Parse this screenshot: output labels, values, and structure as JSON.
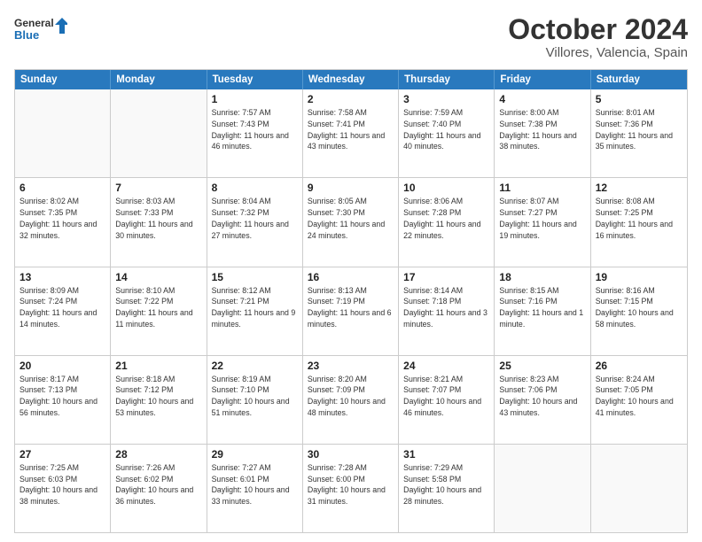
{
  "header": {
    "logo_line1": "General",
    "logo_line2": "Blue",
    "title": "October 2024",
    "subtitle": "Villores, Valencia, Spain"
  },
  "calendar": {
    "days_of_week": [
      "Sunday",
      "Monday",
      "Tuesday",
      "Wednesday",
      "Thursday",
      "Friday",
      "Saturday"
    ],
    "rows": [
      [
        {
          "day": "",
          "info": ""
        },
        {
          "day": "",
          "info": ""
        },
        {
          "day": "1",
          "info": "Sunrise: 7:57 AM\nSunset: 7:43 PM\nDaylight: 11 hours and 46 minutes."
        },
        {
          "day": "2",
          "info": "Sunrise: 7:58 AM\nSunset: 7:41 PM\nDaylight: 11 hours and 43 minutes."
        },
        {
          "day": "3",
          "info": "Sunrise: 7:59 AM\nSunset: 7:40 PM\nDaylight: 11 hours and 40 minutes."
        },
        {
          "day": "4",
          "info": "Sunrise: 8:00 AM\nSunset: 7:38 PM\nDaylight: 11 hours and 38 minutes."
        },
        {
          "day": "5",
          "info": "Sunrise: 8:01 AM\nSunset: 7:36 PM\nDaylight: 11 hours and 35 minutes."
        }
      ],
      [
        {
          "day": "6",
          "info": "Sunrise: 8:02 AM\nSunset: 7:35 PM\nDaylight: 11 hours and 32 minutes."
        },
        {
          "day": "7",
          "info": "Sunrise: 8:03 AM\nSunset: 7:33 PM\nDaylight: 11 hours and 30 minutes."
        },
        {
          "day": "8",
          "info": "Sunrise: 8:04 AM\nSunset: 7:32 PM\nDaylight: 11 hours and 27 minutes."
        },
        {
          "day": "9",
          "info": "Sunrise: 8:05 AM\nSunset: 7:30 PM\nDaylight: 11 hours and 24 minutes."
        },
        {
          "day": "10",
          "info": "Sunrise: 8:06 AM\nSunset: 7:28 PM\nDaylight: 11 hours and 22 minutes."
        },
        {
          "day": "11",
          "info": "Sunrise: 8:07 AM\nSunset: 7:27 PM\nDaylight: 11 hours and 19 minutes."
        },
        {
          "day": "12",
          "info": "Sunrise: 8:08 AM\nSunset: 7:25 PM\nDaylight: 11 hours and 16 minutes."
        }
      ],
      [
        {
          "day": "13",
          "info": "Sunrise: 8:09 AM\nSunset: 7:24 PM\nDaylight: 11 hours and 14 minutes."
        },
        {
          "day": "14",
          "info": "Sunrise: 8:10 AM\nSunset: 7:22 PM\nDaylight: 11 hours and 11 minutes."
        },
        {
          "day": "15",
          "info": "Sunrise: 8:12 AM\nSunset: 7:21 PM\nDaylight: 11 hours and 9 minutes."
        },
        {
          "day": "16",
          "info": "Sunrise: 8:13 AM\nSunset: 7:19 PM\nDaylight: 11 hours and 6 minutes."
        },
        {
          "day": "17",
          "info": "Sunrise: 8:14 AM\nSunset: 7:18 PM\nDaylight: 11 hours and 3 minutes."
        },
        {
          "day": "18",
          "info": "Sunrise: 8:15 AM\nSunset: 7:16 PM\nDaylight: 11 hours and 1 minute."
        },
        {
          "day": "19",
          "info": "Sunrise: 8:16 AM\nSunset: 7:15 PM\nDaylight: 10 hours and 58 minutes."
        }
      ],
      [
        {
          "day": "20",
          "info": "Sunrise: 8:17 AM\nSunset: 7:13 PM\nDaylight: 10 hours and 56 minutes."
        },
        {
          "day": "21",
          "info": "Sunrise: 8:18 AM\nSunset: 7:12 PM\nDaylight: 10 hours and 53 minutes."
        },
        {
          "day": "22",
          "info": "Sunrise: 8:19 AM\nSunset: 7:10 PM\nDaylight: 10 hours and 51 minutes."
        },
        {
          "day": "23",
          "info": "Sunrise: 8:20 AM\nSunset: 7:09 PM\nDaylight: 10 hours and 48 minutes."
        },
        {
          "day": "24",
          "info": "Sunrise: 8:21 AM\nSunset: 7:07 PM\nDaylight: 10 hours and 46 minutes."
        },
        {
          "day": "25",
          "info": "Sunrise: 8:23 AM\nSunset: 7:06 PM\nDaylight: 10 hours and 43 minutes."
        },
        {
          "day": "26",
          "info": "Sunrise: 8:24 AM\nSunset: 7:05 PM\nDaylight: 10 hours and 41 minutes."
        }
      ],
      [
        {
          "day": "27",
          "info": "Sunrise: 7:25 AM\nSunset: 6:03 PM\nDaylight: 10 hours and 38 minutes."
        },
        {
          "day": "28",
          "info": "Sunrise: 7:26 AM\nSunset: 6:02 PM\nDaylight: 10 hours and 36 minutes."
        },
        {
          "day": "29",
          "info": "Sunrise: 7:27 AM\nSunset: 6:01 PM\nDaylight: 10 hours and 33 minutes."
        },
        {
          "day": "30",
          "info": "Sunrise: 7:28 AM\nSunset: 6:00 PM\nDaylight: 10 hours and 31 minutes."
        },
        {
          "day": "31",
          "info": "Sunrise: 7:29 AM\nSunset: 5:58 PM\nDaylight: 10 hours and 28 minutes."
        },
        {
          "day": "",
          "info": ""
        },
        {
          "day": "",
          "info": ""
        }
      ]
    ]
  }
}
